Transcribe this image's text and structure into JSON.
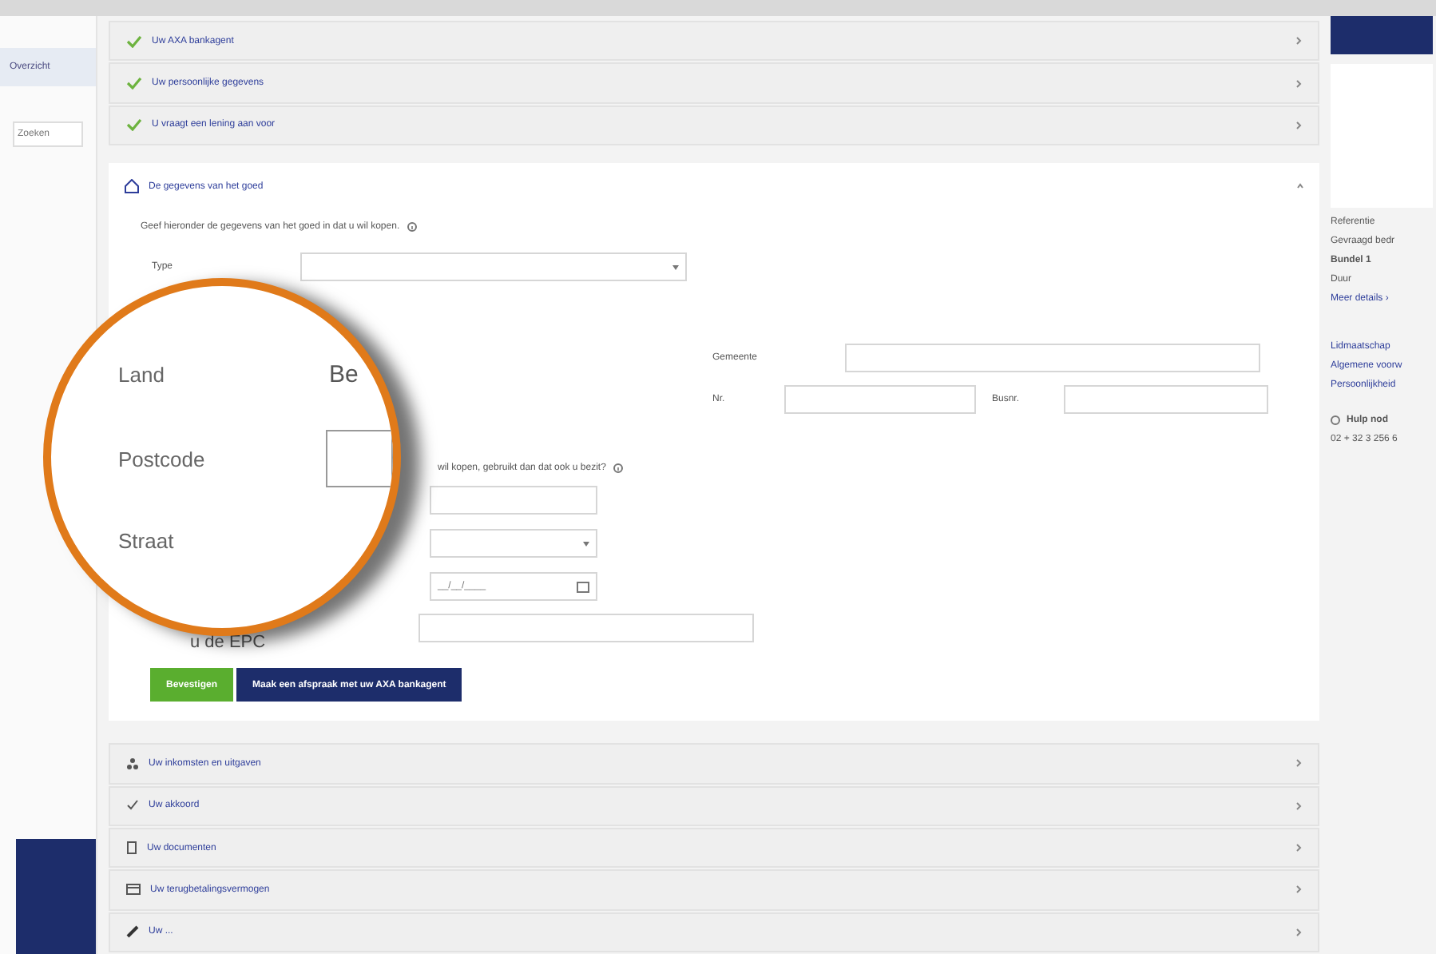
{
  "sidebar": {
    "items": [
      {
        "label": "Overzicht",
        "selected": true
      }
    ],
    "search": {
      "placeholder": "Zoeken"
    }
  },
  "done_steps": [
    {
      "label": "Uw AXA bankagent",
      "done": true
    },
    {
      "label": "Uw persoonlijke gegevens",
      "done": true
    },
    {
      "label": "U vraagt een lening aan voor",
      "done": true
    }
  ],
  "open_step": {
    "title": "De gegevens van het goed",
    "intro": "Geef hieronder de gegevens van het goed in dat u wil kopen.",
    "type_label": "Type",
    "gemeente_label": "Gemeente",
    "nr_label": "Nr.",
    "bus_label": "Busnr.",
    "question": "wil kopen, gebruikt dan dat ook u bezit?",
    "date_value": "__/__/____",
    "epc_label": "u de EPC",
    "buttons": [
      {
        "label": "Bevestigen",
        "kind": "primary"
      },
      {
        "label": "Maak een afspraak met uw AXA bankagent",
        "kind": "secondary"
      }
    ]
  },
  "next_steps": [
    {
      "label": "Uw inkomsten en uitgaven",
      "kind": "people"
    },
    {
      "label": "Uw akkoord",
      "kind": "check"
    },
    {
      "label": "Uw documenten",
      "kind": "document"
    },
    {
      "label": "Uw terugbetalingsvermogen",
      "kind": "card"
    },
    {
      "label": "Uw ...",
      "kind": "pen"
    }
  ],
  "summary": {
    "lines": [
      {
        "text": "Referentie",
        "kind": "plain"
      },
      {
        "text": "Gevraagd bedr",
        "kind": "plain"
      },
      {
        "text": "Bundel 1",
        "kind": "bold"
      },
      {
        "text": "Duur",
        "kind": "plain"
      },
      {
        "text": "Meer details ›",
        "kind": "link"
      }
    ],
    "links": [
      "Lidmaatschap",
      "Algemene voorw",
      "Persoonlijkheid"
    ],
    "help_title": "Hulp nod",
    "help_phone": "02 + 32 3 256 6"
  },
  "magnifier": {
    "rows": [
      {
        "label": "Land",
        "value": "Be"
      },
      {
        "label": "Postcode",
        "kind": "box"
      },
      {
        "label": "Straat"
      }
    ]
  }
}
